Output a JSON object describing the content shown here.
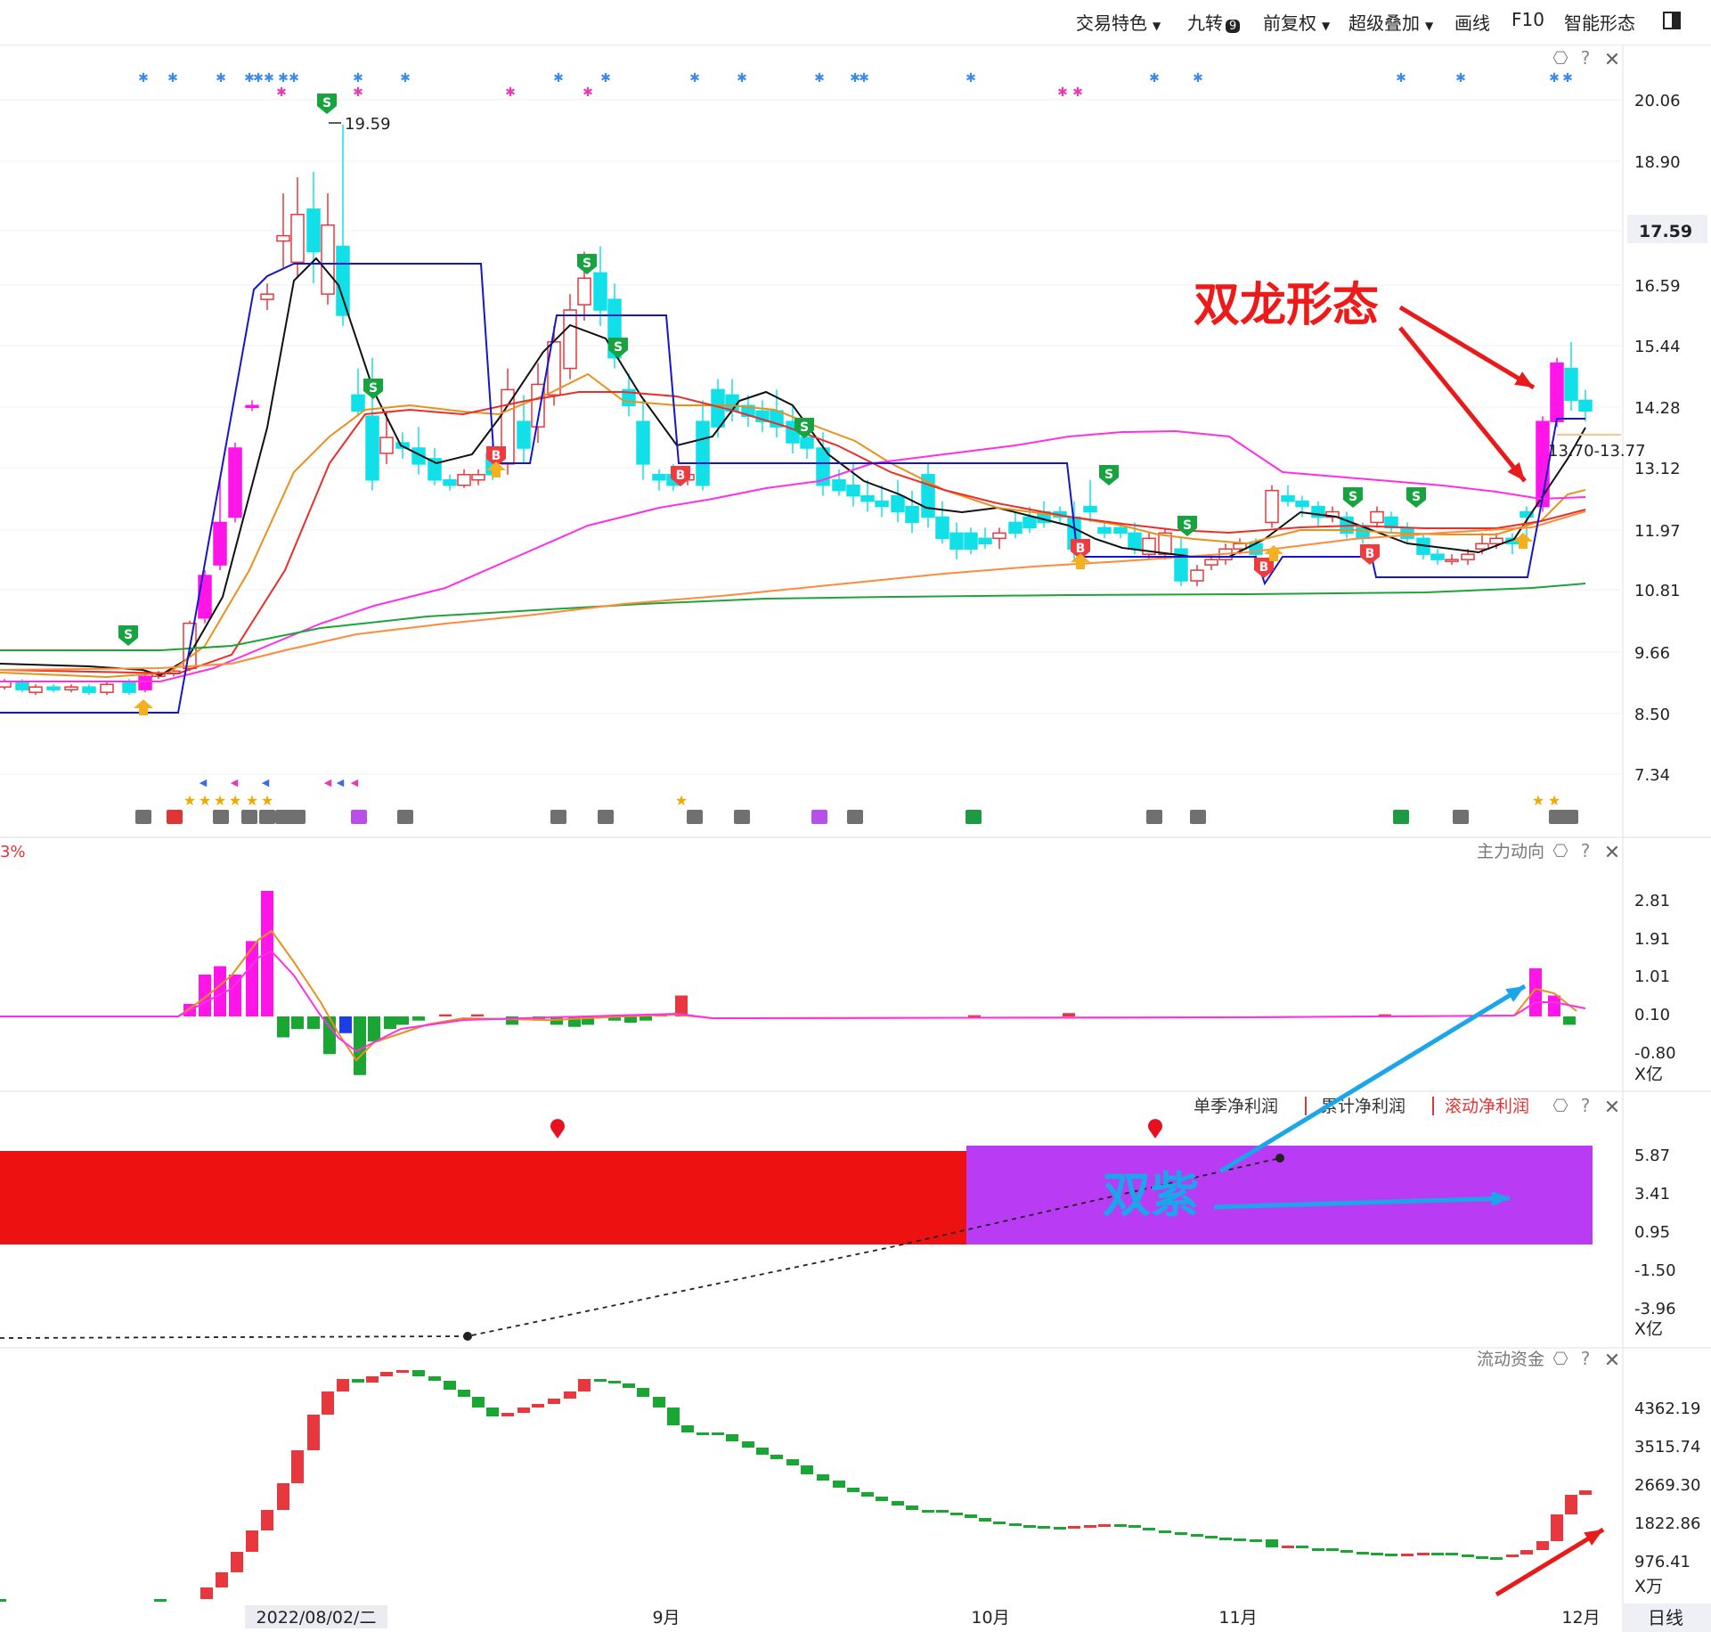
{
  "toolbar": {
    "items": [
      {
        "label": "交易特色",
        "dropdown": true
      },
      {
        "label": "九转",
        "badge": "9"
      },
      {
        "label": "前复权",
        "dropdown": true
      },
      {
        "label": "超级叠加",
        "dropdown": true
      },
      {
        "label": "画线"
      },
      {
        "label": "F10"
      },
      {
        "label": "智能形态"
      }
    ],
    "panel_icon": "panel-toggle-icon"
  },
  "price_panel": {
    "y_ticks": [
      "20.06",
      "18.90",
      "17.59",
      "16.59",
      "15.44",
      "14.28",
      "13.12",
      "11.97",
      "10.81",
      "9.66",
      "8.50",
      "7.34"
    ],
    "current_price": "17.59",
    "peak_label": "19.59",
    "range_label": "13.70-13.77",
    "annotation": "双龙形态",
    "icons": [
      "settings-icon",
      "help-icon",
      "close-icon"
    ]
  },
  "main_force_panel": {
    "title": "主力动向",
    "y_ticks": [
      "2.81",
      "1.91",
      "1.01",
      "0.10",
      "-0.80"
    ],
    "unit": "X亿",
    "left_label": "3%"
  },
  "profit_panel": {
    "tabs": [
      "单季净利润",
      "累计净利润",
      "滚动净利润"
    ],
    "active_tab": "滚动净利润",
    "y_ticks": [
      "5.87",
      "3.41",
      "0.95",
      "-1.50",
      "-3.96"
    ],
    "unit": "X亿",
    "annotation": "双紫"
  },
  "liquidity_panel": {
    "title": "流动资金",
    "y_ticks": [
      "4362.19",
      "3515.74",
      "2669.30",
      "1822.86",
      "976.41"
    ],
    "unit": "X万"
  },
  "x_axis": {
    "labels": [
      "2022/08/02/二",
      "9月",
      "10月",
      "11月",
      "12月"
    ],
    "period": "日线"
  },
  "colors": {
    "up": "#e8383d",
    "down": "#12e0e8",
    "ma5": "#111111",
    "ma10": "#e8911c",
    "ma20": "#e8302a",
    "ma60": "#ff2ee8",
    "ma120": "#1ea33a",
    "ma250": "#ff8a3a",
    "channel": "#1515c9",
    "purple_block": "#b93cf4",
    "red_block": "#ee1111"
  }
}
